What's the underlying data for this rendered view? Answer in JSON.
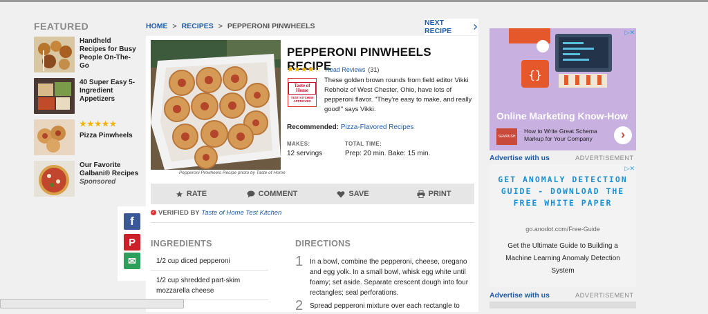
{
  "featured": {
    "title": "FEATURED",
    "items": [
      {
        "title": "Handheld Recipes for Busy People On-The-Go"
      },
      {
        "title": "40 Super Easy 5-Ingredient Appetizers"
      },
      {
        "stars": "★★★★★",
        "title": "Pizza Pinwheels"
      },
      {
        "title": "Our Favorite Galbani® Recipes",
        "sponsored": "Sponsored"
      }
    ]
  },
  "breadcrumb": {
    "home": "HOME",
    "recipes": "RECIPES",
    "current": "PEPPERONI PINWHEELS",
    "sep": ">"
  },
  "next_recipe": {
    "label": "NEXT RECIPE",
    "icon": "chevron-right-icon"
  },
  "recipe": {
    "title": "PEPPERONI PINWHEELS RECIPE",
    "stars": "★★★★☆",
    "rating": 4.5,
    "reviews_link": "Read Reviews",
    "reviews_count": "(31)",
    "badge_title": "Taste of Home",
    "badge_sub": "TEST KITCHEN APPROVED",
    "description": "These golden brown rounds from field editor Vikki Rebholz of West Chester, Ohio, have lots of pepperoni flavor. \"They're easy to make, and really good!\" says Vikki.",
    "recommended_label": "Recommended:",
    "recommended_link": "Pizza-Flavored Recipes",
    "makes_label": "MAKES:",
    "makes_value": "12 servings",
    "total_label": "TOTAL TIME:",
    "total_value": "Prep: 20 min. Bake: 15 min.",
    "caption": "Pepperoni Pinwheels Recipe photo by Taste of Home"
  },
  "actions": [
    {
      "label": "RATE",
      "icon": "star-icon"
    },
    {
      "label": "COMMENT",
      "icon": "comment-icon"
    },
    {
      "label": "SAVE",
      "icon": "heart-icon"
    },
    {
      "label": "PRINT",
      "icon": "print-icon"
    }
  ],
  "verified": {
    "label": "VERIFIED BY",
    "source": "Taste of Home Test Kitchen"
  },
  "ingredients": {
    "title": "INGREDIENTS",
    "items": [
      "1/2 cup diced pepperoni",
      "1/2 cup shredded part-skim mozzarella cheese"
    ]
  },
  "directions": {
    "title": "DIRECTIONS",
    "steps": [
      {
        "num": "1",
        "text": "In a bowl, combine the pepperoni, cheese, oregano and egg yolk. In a small bowl, whisk egg white until foamy; set aside. Separate crescent dough into four rectangles; seal perforations."
      },
      {
        "num": "2",
        "text": "Spread pepperoni mixture over each rectangle to"
      }
    ]
  },
  "social": [
    {
      "name": "facebook",
      "glyph": "f",
      "color": "#3b5998"
    },
    {
      "name": "pinterest",
      "glyph": "P",
      "color": "#cb2027"
    },
    {
      "name": "email",
      "glyph": "✉",
      "color": "#2e9e5b"
    }
  ],
  "ads": {
    "ad1": {
      "headline": "Online Marketing Know-How",
      "sub": "How to Write Great Schema Markup for Your Company",
      "logo": "SEMRUSH"
    },
    "advertise_with_us": "Advertise with us",
    "advertisement": "ADVERTISEMENT",
    "ad2": {
      "headline": "GET ANOMALY DETECTION GUIDE - DOWNLOAD THE FREE WHITE PAPER",
      "url": "go.anodot.com/Free-Guide",
      "body": "Get the Ultimate Guide to Building a Machine Learning Anomaly Detection System"
    }
  }
}
